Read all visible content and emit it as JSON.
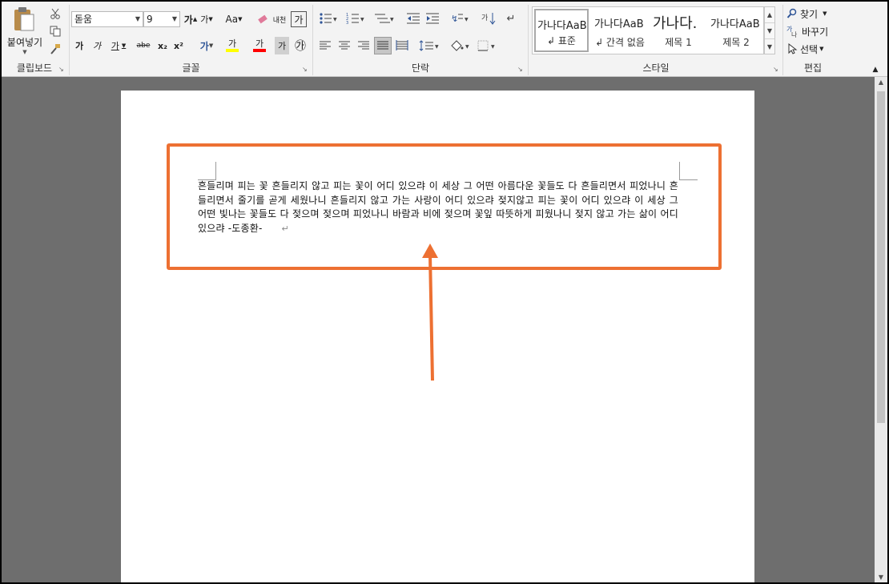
{
  "ribbon": {
    "clipboard": {
      "label": "클립보드",
      "paste_label": "붙여넣기"
    },
    "font": {
      "label": "글꼴",
      "font_name": "돋움",
      "font_size": "9",
      "grow_label": "가",
      "shrink_label": "가",
      "case_label": "Aa",
      "clear_format_label": "내",
      "phonetic_label": "내천",
      "box_label": "가",
      "bold_label": "가",
      "italic_label": "가",
      "underline_label": "가",
      "strike_label": "abe",
      "subscript_label": "x₂",
      "superscript_label": "x²",
      "effects_label": "가",
      "highlight_label": "가",
      "font_color_label": "가",
      "shading_label": "가",
      "enclose_label": "㉮"
    },
    "paragraph": {
      "label": "단락"
    },
    "styles": {
      "label": "스타일",
      "items": [
        {
          "sample": "가나다AaB",
          "name": "↲ 표준"
        },
        {
          "sample": "가나다AaB",
          "name": "↲ 간격 없음"
        },
        {
          "sample": "가나다.",
          "name": "제목 1"
        },
        {
          "sample": "가나다AaB",
          "name": "제목 2"
        }
      ]
    },
    "editing": {
      "label": "편집",
      "find_label": "찾기",
      "replace_label": "바꾸기",
      "select_label": "선택"
    }
  },
  "colors": {
    "accent": "#ed7032",
    "highlight_yellow": "#ffff00",
    "font_red": "#ff0000",
    "effects_blue": "#2f5597"
  },
  "document": {
    "text": "흔들리며 피는 꽃    흔들리지 않고 피는 꽃이 어디 있으랴 이 세상 그 어떤 아름다운 꽃들도 다 흔들리면서 피었나니 흔들리면서 줄기를 곧게 세웠나니 흔들리지 않고 가는 사랑이 어디 있으랴    젖지않고 피는 꽃이 어디 있으랴 이 세상 그 어떤 빛나는 꽃들도 다 젖으며 젖으며 피었나니 바람과 비에 젖으며 꽃잎 따뜻하게 피웠나니 젖지 않고 가는 삶이 어디 있으랴 -도종환-",
    "paragraph_mark": "↵"
  }
}
